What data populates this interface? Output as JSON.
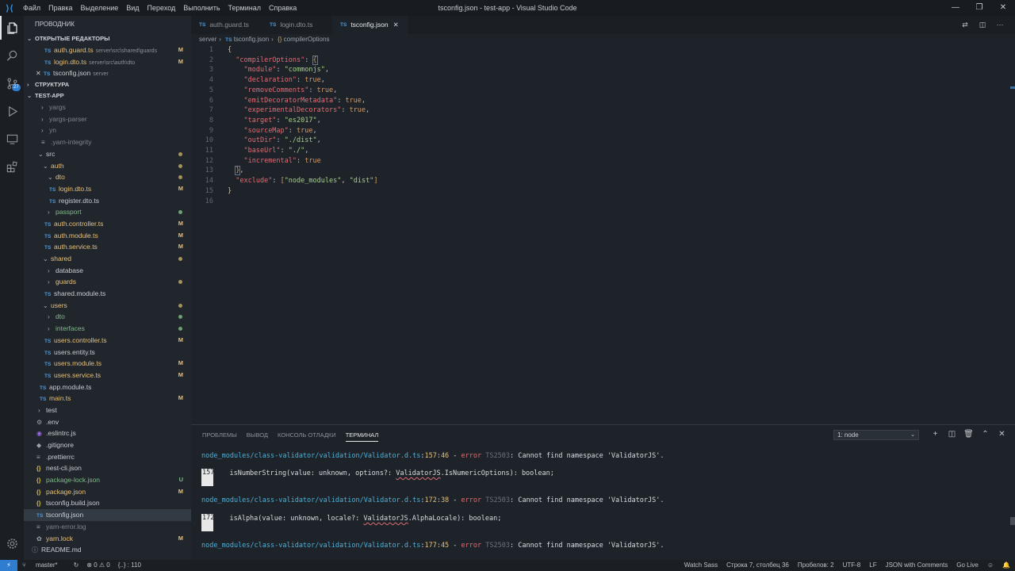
{
  "window": {
    "title": "tsconfig.json - test-app - Visual Studio Code",
    "menu": [
      "Файл",
      "Правка",
      "Выделение",
      "Вид",
      "Переход",
      "Выполнить",
      "Терминал",
      "Справка"
    ],
    "controls": {
      "minimize": "—",
      "restore": "❐",
      "close": "✕"
    }
  },
  "activity_bar": {
    "items": [
      {
        "name": "explorer-icon",
        "active": true
      },
      {
        "name": "search-icon"
      },
      {
        "name": "source-control-icon",
        "badge": "27"
      },
      {
        "name": "run-debug-icon"
      },
      {
        "name": "remote-explorer-icon"
      },
      {
        "name": "extensions-icon"
      }
    ],
    "settings": "settings-gear-icon"
  },
  "sidebar": {
    "title": "ПРОВОДНИК",
    "open_editors_label": "ОТКРЫТЫЕ РЕДАКТОРЫ",
    "open_editors": [
      {
        "icon": "TS",
        "name": "auth.guard.ts",
        "desc": "server\\src\\shared\\guards",
        "mark": "M"
      },
      {
        "icon": "TS",
        "name": "login.dto.ts",
        "desc": "server\\src\\auth\\dto",
        "mark": "M"
      },
      {
        "icon": "{}",
        "name": "tsconfig.json",
        "desc": "server",
        "mark": ""
      }
    ],
    "outline_label": "СТРУКТУРА",
    "project_label": "TEST-APP",
    "tree": [
      {
        "name": "yargs",
        "mark": ""
      },
      {
        "name": "yargs-parser",
        "mark": ""
      },
      {
        "name": "yn",
        "mark": ""
      },
      {
        "name": ".yarn-integrity",
        "mark": ""
      },
      {
        "name": "src",
        "mark": ""
      },
      {
        "name": "auth",
        "mark": ""
      },
      {
        "name": "dto",
        "mark": ""
      },
      {
        "name": "login.dto.ts",
        "mark": "M"
      },
      {
        "name": "register.dto.ts",
        "mark": ""
      },
      {
        "name": "passport",
        "mark": ""
      },
      {
        "name": "auth.controller.ts",
        "mark": "M"
      },
      {
        "name": "auth.module.ts",
        "mark": "M"
      },
      {
        "name": "auth.service.ts",
        "mark": "M"
      },
      {
        "name": "shared",
        "mark": ""
      },
      {
        "name": "database",
        "mark": ""
      },
      {
        "name": "guards",
        "mark": ""
      },
      {
        "name": "shared.module.ts",
        "mark": ""
      },
      {
        "name": "users",
        "mark": ""
      },
      {
        "name": "dto",
        "mark": ""
      },
      {
        "name": "interfaces",
        "mark": ""
      },
      {
        "name": "users.controller.ts",
        "mark": "M"
      },
      {
        "name": "users.entity.ts",
        "mark": ""
      },
      {
        "name": "users.module.ts",
        "mark": "M"
      },
      {
        "name": "users.service.ts",
        "mark": "M"
      },
      {
        "name": "app.module.ts",
        "mark": ""
      },
      {
        "name": "main.ts",
        "mark": "M"
      },
      {
        "name": "test",
        "mark": ""
      },
      {
        "name": ".env",
        "mark": ""
      },
      {
        "name": ".eslintrc.js",
        "mark": ""
      },
      {
        "name": ".gitignore",
        "mark": ""
      },
      {
        "name": ".prettierrc",
        "mark": ""
      },
      {
        "name": "nest-cli.json",
        "mark": ""
      },
      {
        "name": "package-lock.json",
        "mark": "U"
      },
      {
        "name": "package.json",
        "mark": "M"
      },
      {
        "name": "tsconfig.build.json",
        "mark": ""
      },
      {
        "name": "tsconfig.json",
        "mark": ""
      },
      {
        "name": "yarn-error.log",
        "mark": ""
      },
      {
        "name": "yarn.lock",
        "mark": "M"
      },
      {
        "name": "README.md",
        "mark": ""
      }
    ]
  },
  "tabs": [
    {
      "icon": "TS",
      "label": "auth.guard.ts"
    },
    {
      "icon": "TS",
      "label": "login.dto.ts"
    },
    {
      "icon": "TS",
      "label": "tsconfig.json",
      "close": "✕"
    }
  ],
  "breadcrumb": {
    "folder": "server",
    "file": "tsconfig.json",
    "symbol": "compilerOptions"
  },
  "code_lines": [
    "1",
    "2",
    "3",
    "4",
    "5",
    "6",
    "7",
    "8",
    "9",
    "10",
    "11",
    "12",
    "13",
    "14",
    "15",
    "16"
  ],
  "code": {
    "module": "\"module\"",
    "commonjs": "\"commonjs\"",
    "declaration": "\"declaration\"",
    "removeComments": "\"removeComments\"",
    "emitDecoratorMetadata": "\"emitDecoratorMetadata\"",
    "experimentalDecorators": "\"experimentalDecorators\"",
    "target": "\"target\"",
    "es2017": "\"es2017\"",
    "sourceMap": "\"sourceMap\"",
    "outDir": "\"outDir\"",
    "dist_path": "\"./dist\"",
    "baseUrl": "\"baseUrl\"",
    "base_path": "\"./\"",
    "incremental": "\"incremental\"",
    "exclude": "\"exclude\"",
    "node_modules": "\"node_modules\"",
    "dist": "\"dist\"",
    "compilerOptions": "\"compilerOptions\"",
    "true": "true"
  },
  "panel": {
    "tabs": [
      "ПРОБЛЕМЫ",
      "ВЫВОД",
      "КОНСОЛЬ ОТЛАДКИ",
      "ТЕРМИНАЛ"
    ],
    "terminal_select": "1: node",
    "terminal": {
      "e1": {
        "path": "node_modules/class-validator/validation/Validator.d.ts",
        "loc": "157:46",
        "code": "TS2503",
        "msg": "Cannot find namespace 'ValidatorJS'."
      },
      "c1": {
        "ln": "157",
        "pre": "    isNumberString(value: unknown, options?: ",
        "sq": "ValidatorJS",
        "post": ".IsNumericOptions): boolean;"
      },
      "e2": {
        "path": "node_modules/class-validator/validation/Validator.d.ts",
        "loc": "172:38",
        "code": "TS2503",
        "msg": "Cannot find namespace 'ValidatorJS'."
      },
      "c2": {
        "ln": "172",
        "pre": "    isAlpha(value: unknown, locale?: ",
        "sq": "ValidatorJS",
        "post": ".AlphaLocale): boolean;"
      },
      "e3": {
        "path": "node_modules/class-validator/validation/Validator.d.ts",
        "loc": "177:45",
        "code": "TS2503",
        "msg": "Cannot find namespace 'ValidatorJS'."
      },
      "error_word": "error"
    }
  },
  "statusbar": {
    "remote": "⚡",
    "branch": "master*",
    "sync": "↻",
    "problems": "⊗ 0 ⚠ 0",
    "position_hint": "{..} : 110",
    "watch_sass": "Watch Sass",
    "cursor": "Строка 7, столбец 36",
    "indent": "Пробелов: 2",
    "encoding": "UTF-8",
    "eol": "LF",
    "language": "JSON with Comments",
    "live": "Go Live"
  }
}
